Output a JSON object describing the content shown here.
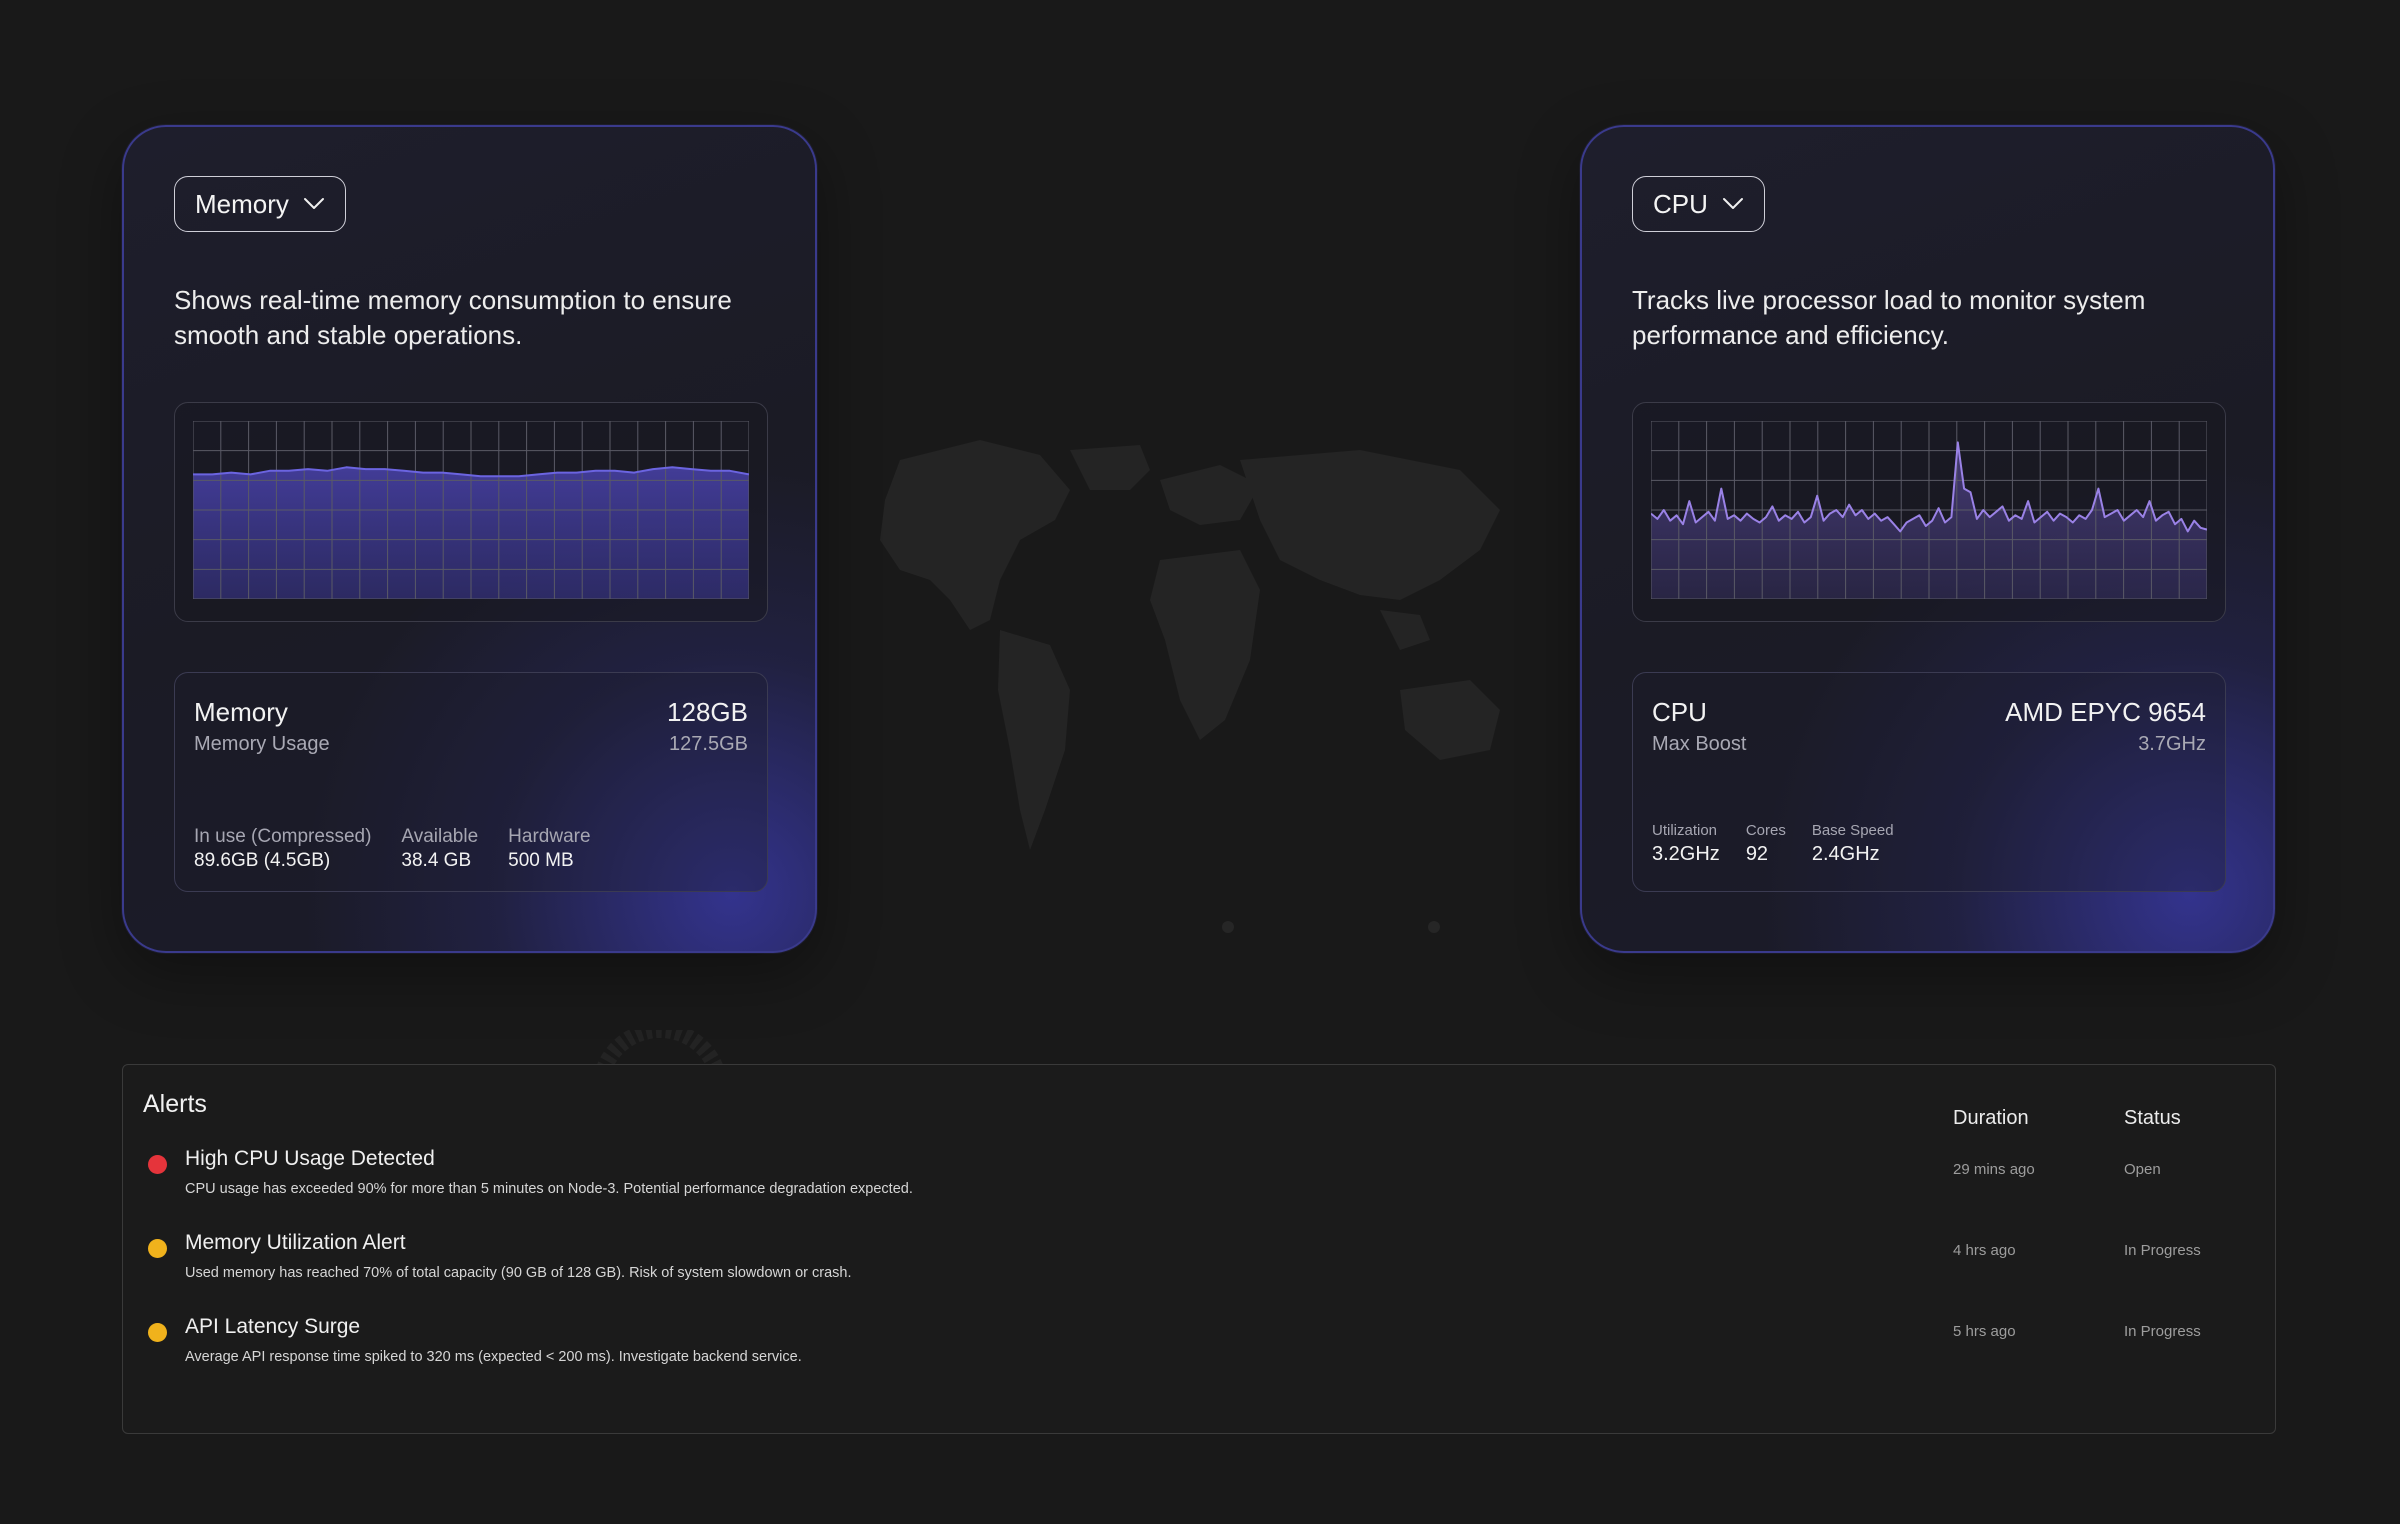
{
  "colors": {
    "background": "#191919",
    "card_accent": "#3a3a8c",
    "chart_line": "#8070d8",
    "alert_red": "#e5343b",
    "alert_yellow": "#f0b21c"
  },
  "memory_card": {
    "dropdown_label": "Memory",
    "description": "Shows real-time memory consumption to ensure smooth and stable operations.",
    "info": {
      "title": "Memory",
      "subtitle": "Memory Usage",
      "value": "128GB",
      "value_sub": "127.5GB"
    },
    "stats": [
      {
        "label": "In use (Compressed)",
        "value": "89.6GB (4.5GB)"
      },
      {
        "label": "Available",
        "value": "38.4 GB"
      },
      {
        "label": "Hardware",
        "value": "500 MB"
      }
    ],
    "chart_values": [
      0.7,
      0.7,
      0.71,
      0.7,
      0.72,
      0.72,
      0.73,
      0.72,
      0.74,
      0.73,
      0.73,
      0.72,
      0.71,
      0.71,
      0.7,
      0.69,
      0.69,
      0.69,
      0.7,
      0.71,
      0.71,
      0.72,
      0.72,
      0.71,
      0.73,
      0.74,
      0.73,
      0.72,
      0.72,
      0.7
    ]
  },
  "cpu_card": {
    "dropdown_label": "CPU",
    "description": "Tracks live processor load to monitor system performance and efficiency.",
    "info": {
      "title": "CPU",
      "subtitle": "Max Boost",
      "value": "AMD EPYC 9654",
      "value_sub": "3.7GHz"
    },
    "stats": [
      {
        "label": "Utilization",
        "value": "3.2GHz"
      },
      {
        "label": "Cores",
        "value": "92"
      },
      {
        "label": "Base Speed",
        "value": "2.4GHz"
      }
    ],
    "chart_values": [
      0.48,
      0.45,
      0.5,
      0.44,
      0.47,
      0.42,
      0.55,
      0.43,
      0.46,
      0.49,
      0.44,
      0.62,
      0.45,
      0.47,
      0.44,
      0.48,
      0.45,
      0.43,
      0.46,
      0.52,
      0.44,
      0.47,
      0.45,
      0.49,
      0.43,
      0.46,
      0.58,
      0.44,
      0.48,
      0.5,
      0.46,
      0.53,
      0.47,
      0.5,
      0.45,
      0.48,
      0.44,
      0.46,
      0.42,
      0.38,
      0.43,
      0.45,
      0.47,
      0.41,
      0.44,
      0.51,
      0.43,
      0.46,
      0.88,
      0.62,
      0.6,
      0.45,
      0.5,
      0.46,
      0.49,
      0.52,
      0.44,
      0.47,
      0.45,
      0.55,
      0.43,
      0.46,
      0.49,
      0.44,
      0.48,
      0.46,
      0.43,
      0.47,
      0.45,
      0.5,
      0.62,
      0.46,
      0.48,
      0.5,
      0.44,
      0.47,
      0.5,
      0.46,
      0.55,
      0.44,
      0.47,
      0.49,
      0.42,
      0.45,
      0.38,
      0.44,
      0.4,
      0.39
    ]
  },
  "alerts": {
    "title": "Alerts",
    "columns": {
      "duration": "Duration",
      "status": "Status"
    },
    "items": [
      {
        "title": "High CPU Usage Detected",
        "description": "CPU usage has exceeded 90% for more than 5 minutes on Node-3. Potential performance degradation expected.",
        "duration": "29 mins ago",
        "status": "Open",
        "severity_color": "#e5343b"
      },
      {
        "title": "Memory Utilization Alert",
        "description": "Used memory has reached 70% of total capacity (90 GB of 128 GB). Risk of system slowdown or crash.",
        "duration": "4 hrs ago",
        "status": "In Progress",
        "severity_color": "#f0b21c"
      },
      {
        "title": "API Latency Surge",
        "description": "Average API response time spiked to 320 ms (expected < 200 ms). Investigate backend service.",
        "duration": "5 hrs ago",
        "status": "In Progress",
        "severity_color": "#f0b21c"
      }
    ]
  }
}
